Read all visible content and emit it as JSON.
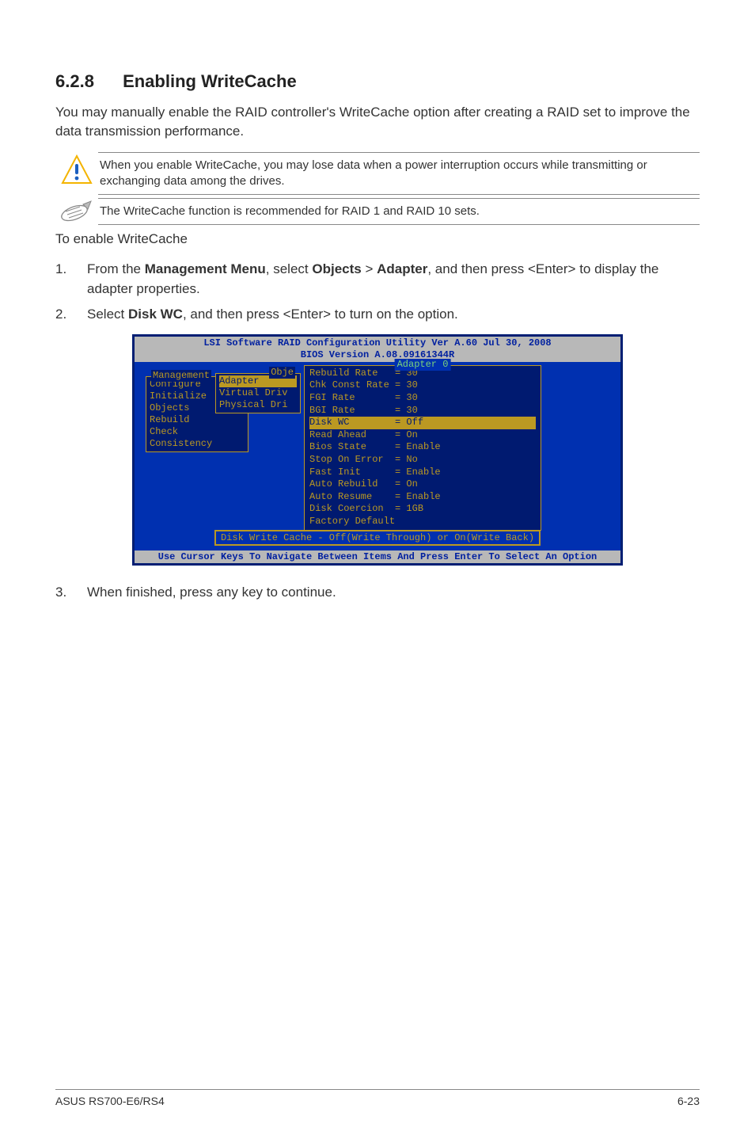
{
  "heading": {
    "number": "6.2.8",
    "title": "Enabling WriteCache"
  },
  "intro": "You may manually enable the RAID controller's WriteCache option after creating a RAID set to improve the data transmission performance.",
  "warning": "When you enable WriteCache, you may lose data when a power interruption occurs while transmitting or exchanging data among the drives.",
  "note": "The WriteCache function is recommended for RAID 1 and RAID 10 sets.",
  "lead": "To enable WriteCache",
  "steps": {
    "s1": {
      "num": "1.",
      "a": "From the ",
      "b": "Management Menu",
      "c": ", select ",
      "d": "Objects",
      "e": " > ",
      "f": "Adapter",
      "g": ", and then press <Enter> to display the adapter properties."
    },
    "s2": {
      "num": "2.",
      "a": "Select ",
      "b": "Disk WC",
      "c": ", and then press <Enter> to turn on the option."
    },
    "s3": {
      "num": "3.",
      "text": "When finished, press any key to continue."
    }
  },
  "bios": {
    "title1": "LSI Software RAID Configuration Utility Ver A.60 Jul 30, 2008",
    "title2": "BIOS Version   A.08.09161344R",
    "menu1_label": "Management",
    "menu1": [
      "Configure",
      "Initialize",
      "Objects",
      "Rebuild",
      "Check Consistency"
    ],
    "menu2_label": "Obje",
    "menu2_sel": "Adapter",
    "menu2": [
      "Virtual Driv",
      "Physical Dri"
    ],
    "adapter_label": "Adapter 0",
    "adapter_rows": [
      "Rebuild Rate   = 30",
      "Chk Const Rate = 30",
      "FGI Rate       = 30",
      "BGI Rate       = 30"
    ],
    "adapter_sel": "Disk WC        = Off",
    "adapter_rows2": [
      "Read Ahead     = On",
      "Bios State     = Enable",
      "Stop On Error  = No",
      "Fast Init      = Enable",
      "Auto Rebuild   = On",
      "Auto Resume    = Enable",
      "Disk Coercion  = 1GB",
      "Factory Default"
    ],
    "hint": "Disk Write Cache - Off(Write Through) or On(Write Back)",
    "footer": "Use Cursor Keys To Navigate Between Items And Press Enter To Select An Option"
  },
  "chart_data": {
    "type": "table",
    "title": "Adapter 0 properties",
    "rows": [
      {
        "name": "Rebuild Rate",
        "value": "30"
      },
      {
        "name": "Chk Const Rate",
        "value": "30"
      },
      {
        "name": "FGI Rate",
        "value": "30"
      },
      {
        "name": "BGI Rate",
        "value": "30"
      },
      {
        "name": "Disk WC",
        "value": "Off"
      },
      {
        "name": "Read Ahead",
        "value": "On"
      },
      {
        "name": "Bios State",
        "value": "Enable"
      },
      {
        "name": "Stop On Error",
        "value": "No"
      },
      {
        "name": "Fast Init",
        "value": "Enable"
      },
      {
        "name": "Auto Rebuild",
        "value": "On"
      },
      {
        "name": "Auto Resume",
        "value": "Enable"
      },
      {
        "name": "Disk Coercion",
        "value": "1GB"
      },
      {
        "name": "Factory Default",
        "value": ""
      }
    ]
  },
  "footer": {
    "left": "ASUS RS700-E6/RS4",
    "right": "6-23"
  }
}
